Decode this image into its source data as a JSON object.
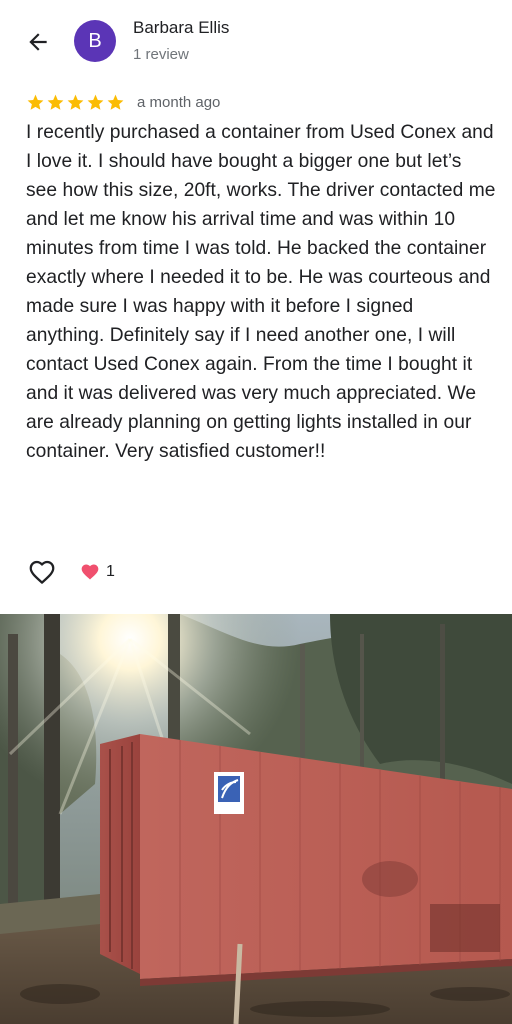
{
  "header": {
    "back_icon": "arrow-left-icon",
    "avatar_letter": "B",
    "avatar_color": "#5b35b6",
    "reviewer_name": "Barbara Ellis",
    "review_count": "1 review"
  },
  "review": {
    "rating": 5,
    "max_rating": 5,
    "star_color": "#fbbc04",
    "date": "a month ago",
    "text": "I recently purchased a container from Used Conex and I love it. I should have bought a bigger one but let’s see how this size, 20ft, works. The driver contacted me and let me know his arrival time and was within 10 minutes from time I was told. He backed the container exactly where I needed it to be. He was courteous and made sure I was happy with it before I signed anything. Definitely say if I need another one, I will contact Used Conex again. From the time I bought it and it was delivered was very much appreciated. We are already planning on getting lights installed in our container. Very satisfied customer!!"
  },
  "actions": {
    "like_icon": "heart-outline-icon",
    "reaction_icon": "heart-filled-icon",
    "reaction_color": "#f0506e",
    "reaction_count": "1"
  },
  "photo": {
    "subject": "red shipping container in wooded yard",
    "container_color": "#b2504a"
  }
}
